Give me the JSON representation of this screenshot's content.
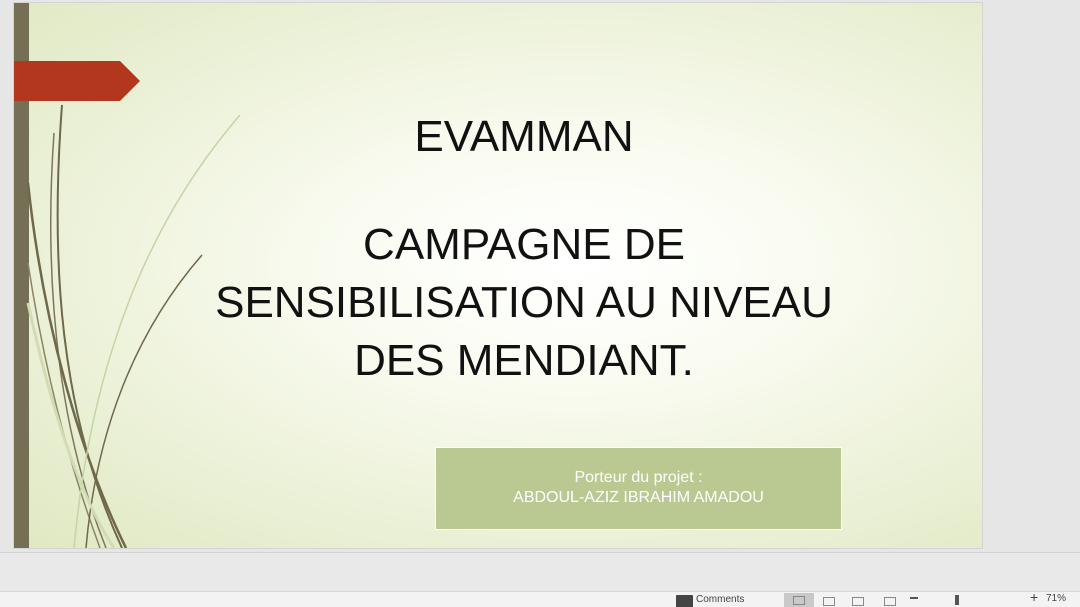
{
  "slide": {
    "title_line1": "EVAMMAN",
    "title_line2": "CAMPAGNE DE",
    "title_line3": "SENSIBILISATION AU NIVEAU",
    "title_line4": "DES MENDIANT.",
    "subtitle_line1": "Porteur du projet :",
    "subtitle_line2": "ABDOUL-AZIZ IBRAHIM AMADOU"
  },
  "status_bar": {
    "comments_label": "Comments",
    "zoom_level": "71%"
  },
  "colors": {
    "accent_red": "#b3361e",
    "left_bar": "#746f55",
    "subtitle_box": "#bac992",
    "stem_dark": "#6f684a",
    "stem_light": "#c7d3a6"
  },
  "icons": {
    "comments": "comments-icon",
    "normal_view": "normal-view-icon",
    "slide_sorter": "slide-sorter-icon",
    "reading_view": "reading-view-icon",
    "slideshow": "slideshow-icon"
  }
}
